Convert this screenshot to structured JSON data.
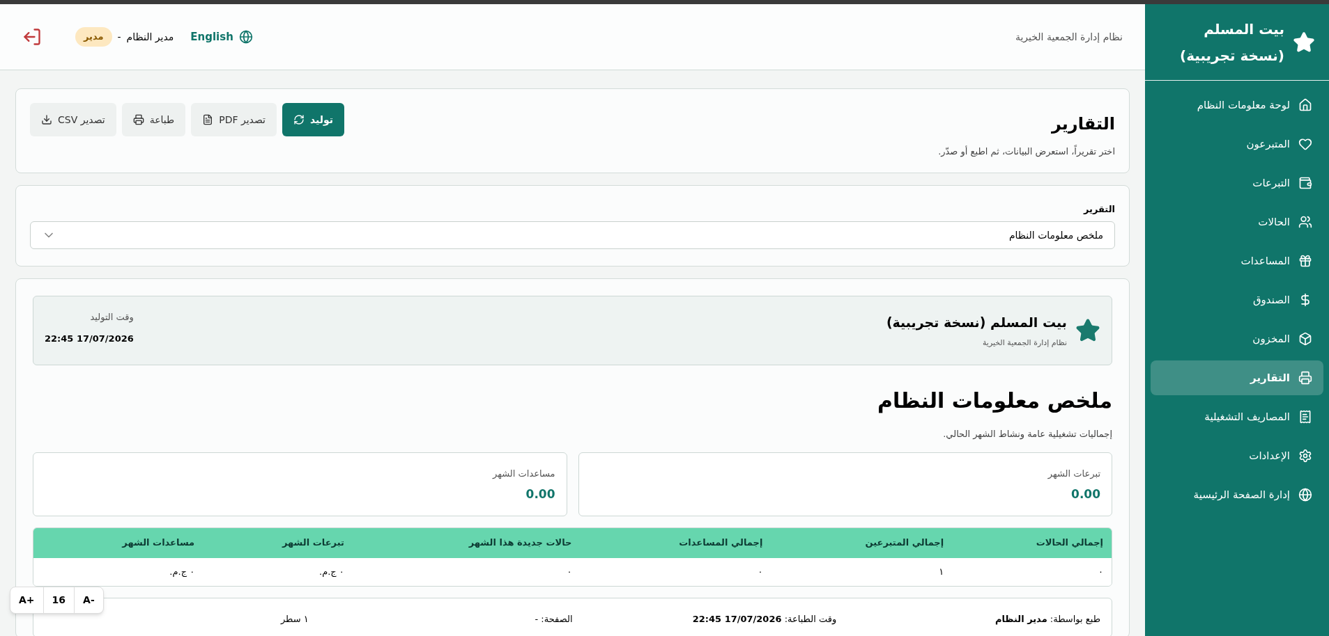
{
  "sidebar": {
    "title": "بيت المسلم (نسخة تجريبية)",
    "items": [
      {
        "label": "لوحة معلومات النظام",
        "selected": false
      },
      {
        "label": "المتبرعون",
        "selected": false
      },
      {
        "label": "التبرعات",
        "selected": false
      },
      {
        "label": "الحالات",
        "selected": false
      },
      {
        "label": "المساعدات",
        "selected": false
      },
      {
        "label": "الصندوق",
        "selected": false
      },
      {
        "label": "المخزون",
        "selected": false
      },
      {
        "label": "التقارير",
        "selected": true
      },
      {
        "label": "المصاريف التشغيلية",
        "selected": false
      },
      {
        "label": "الإعدادات",
        "selected": false
      },
      {
        "label": "إدارة الصفحة الرئيسية",
        "selected": false
      }
    ]
  },
  "header": {
    "subtitle": "نظام إدارة الجمعية الخيرية",
    "language": "English",
    "user": "مدير النظام",
    "separator": "-",
    "role": "مدير"
  },
  "reports": {
    "title": "التقارير",
    "description": "اختر تقريراً، استعرض البيانات، ثم اطبع أو صدّر.",
    "buttons": [
      {
        "label": "توليد",
        "primary": true
      },
      {
        "label": "تصدير PDF",
        "primary": false
      },
      {
        "label": "طباعة",
        "primary": false
      },
      {
        "label": "تصدير CSV",
        "primary": false
      }
    ]
  },
  "report_select": {
    "label": "التقرير",
    "value": "ملخص معلومات النظام"
  },
  "preview": {
    "org_name": "بيت المسلم (نسخة تجريبية)",
    "org_subtitle": "نظام إدارة الجمعية الخيرية",
    "generated_label": "وقت التوليد",
    "generated_value": "22:45 17/07/2026",
    "title": "ملخص معلومات النظام",
    "description": "إجماليات تشغيلية عامة ونشاط الشهر الحالي.",
    "stats": [
      {
        "label": "تبرعات الشهر",
        "value": "0.00"
      },
      {
        "label": "مساعدات الشهر",
        "value": "0.00"
      }
    ],
    "table": {
      "columns": [
        "إجمالي الحالات",
        "إجمالي المتبرعين",
        "إجمالي المساعدات",
        "حالات جديدة هذا الشهر",
        "تبرعات الشهر",
        "مساعدات الشهر"
      ],
      "rows": [
        [
          "٠",
          "١",
          "٠",
          "٠",
          "٠ ج.م.",
          "٠ ج.م."
        ]
      ]
    },
    "footer": [
      "طبع بواسطة: **مدير النظام**",
      "وقت الطباعة: **22:45 17/07/2026**",
      "الصفحة: -",
      "١ سطر"
    ]
  },
  "font_size": {
    "increase": "A+",
    "value": "16",
    "decrease": "A-"
  }
}
